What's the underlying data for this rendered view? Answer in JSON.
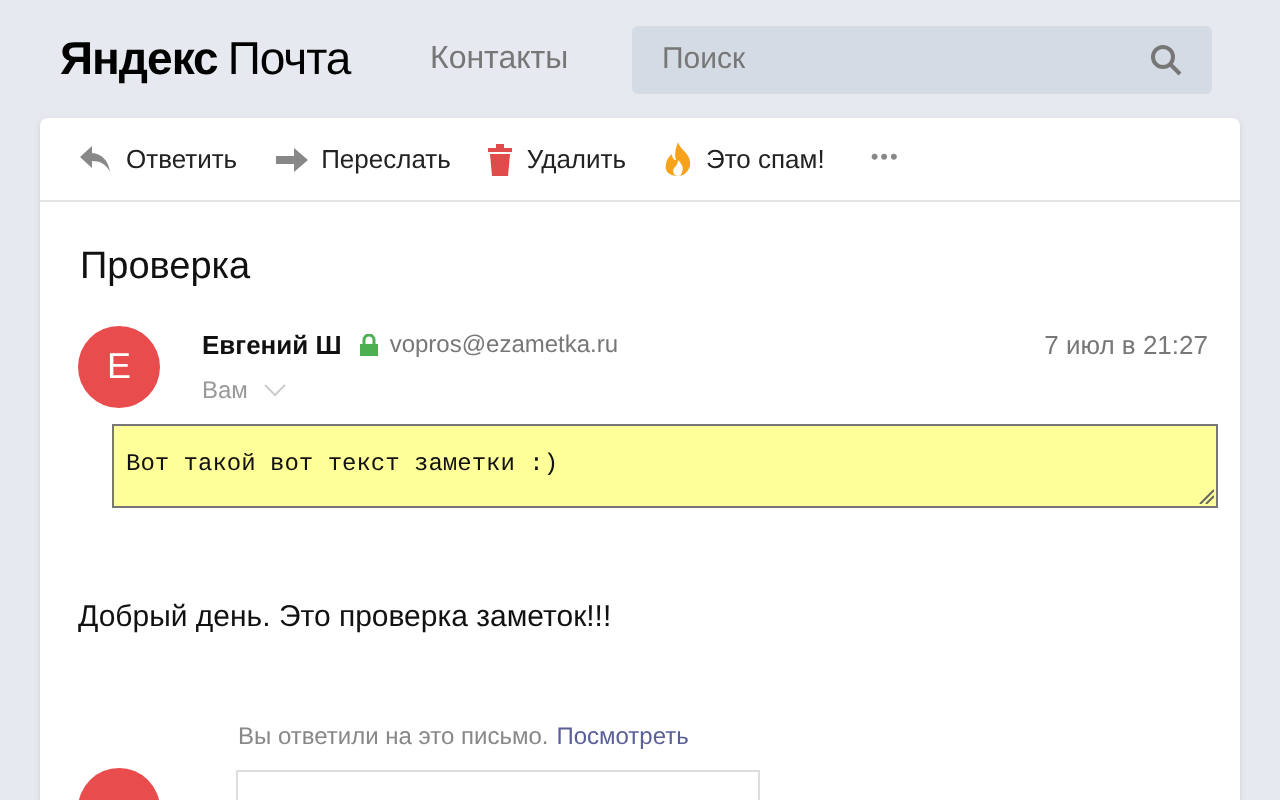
{
  "header": {
    "logo_bold": "Яндекс",
    "logo_light": "Почта",
    "nav_link": "Контакты",
    "search": {
      "placeholder": "Поиск"
    }
  },
  "toolbar": [
    {
      "kind": "reply",
      "label": "Ответить"
    },
    {
      "kind": "forward",
      "label": "Переслать"
    },
    {
      "kind": "delete",
      "label": "Удалить"
    },
    {
      "kind": "spam",
      "label": "Это спам!"
    },
    {
      "kind": "more",
      "label": "•••"
    }
  ],
  "message": {
    "subject": "Проверка",
    "avatar_letter": "Е",
    "sender": "Евгений Ш",
    "email": "vopros@ezametka.ru",
    "recipient": "Вам",
    "date": "7 июл в 21:27",
    "note": "Вот такой вот текст заметки :)",
    "body": "Добрый день. Это проверка заметок!!!",
    "replied_text": "Вы ответили на это письмо.",
    "replied_link": "Посмотреть"
  }
}
